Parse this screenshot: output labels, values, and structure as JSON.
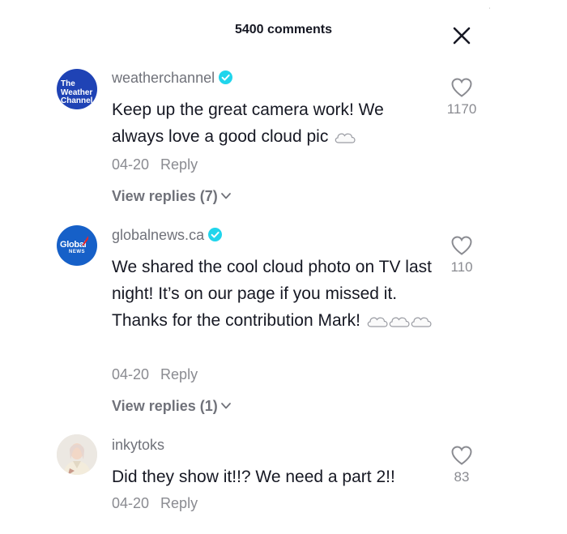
{
  "header": {
    "title": "5400 comments"
  },
  "comments": [
    {
      "avatar_label_lines": [
        "The",
        "Weather",
        "Channel"
      ],
      "username": "weatherchannel",
      "verified": true,
      "text": "Keep up the great camera work! We always love a good cloud pic",
      "emoji_count": 1,
      "date": "04-20",
      "reply_label": "Reply",
      "view_replies": "View replies (7)",
      "likes": "1170"
    },
    {
      "avatar_label": "Global",
      "avatar_sublabel": "NEWS",
      "username": "globalnews.ca",
      "verified": true,
      "text": "We shared the cool cloud photo on TV last night! It’s on our page if you missed it. Thanks for the contribution Mark!",
      "emoji_count": 3,
      "date": "04-20",
      "reply_label": "Reply",
      "view_replies": "View replies (1)",
      "likes": "110"
    },
    {
      "username": "inkytoks",
      "verified": false,
      "text": "Did they show it!!? We need a part 2!!",
      "date": "04-20",
      "reply_label": "Reply",
      "likes": "83"
    }
  ],
  "icons": {
    "close": "close-icon",
    "heart": "heart-outline-icon",
    "verified": "verified-badge-icon",
    "chevron": "chevron-down-icon",
    "cloud": "cloud-emoji"
  },
  "colors": {
    "verified": "#20d5ec",
    "twc_blue": "#1f43b5",
    "global_blue": "#1660c8",
    "global_red": "#e3262b"
  }
}
